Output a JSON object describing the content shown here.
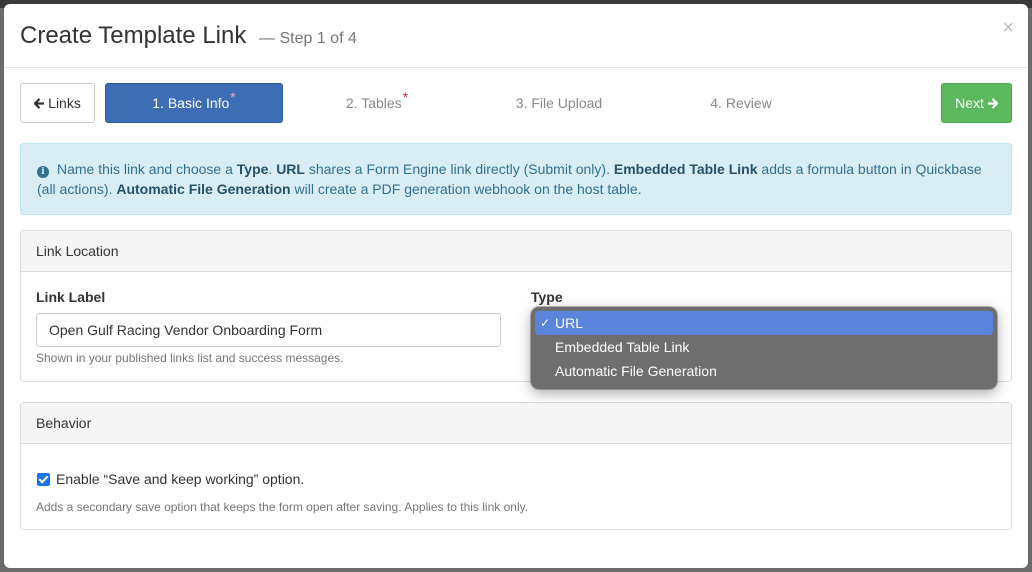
{
  "modal": {
    "title": "Create Template Link",
    "step": "— Step 1 of 4",
    "close": "×"
  },
  "wizard": {
    "back_label": "Links",
    "steps": [
      {
        "label": "1. Basic Info",
        "required": "*"
      },
      {
        "label": "2. Tables",
        "required": "*"
      },
      {
        "label": "3. File Upload"
      },
      {
        "label": "4. Review"
      }
    ],
    "next_label": "Next"
  },
  "info": {
    "p1": "Name this link and choose a ",
    "b1": "Type",
    "p2": ". ",
    "b2": "URL",
    "p3": " shares a Form Engine link directly (Submit only). ",
    "b3": "Embedded Table Link",
    "p4": " adds a formula button in Quickbase (all actions). ",
    "b4": "Automatic File Generation",
    "p5": " will create a PDF generation webhook on the host table."
  },
  "link_location": {
    "heading": "Link Location",
    "label_field": {
      "label": "Link Label",
      "value": "Open Gulf Racing Vendor Onboarding Form",
      "help": "Shown in your published links list and success messages."
    },
    "type_field": {
      "label": "Type",
      "options": [
        "URL",
        "Embedded Table Link",
        "Automatic File Generation"
      ],
      "selected": "URL"
    }
  },
  "behavior": {
    "heading": "Behavior",
    "checkbox_label": "Enable “Save and keep working” option.",
    "checked": true,
    "help": "Adds a secondary save option that keeps the form open after saving. Applies to this link only."
  },
  "colors": {
    "primary": "#3d6eb5",
    "success": "#5cb85c",
    "info_bg": "#d9edf7",
    "info_text": "#31708f",
    "dropdown_selected": "#5b84dd"
  }
}
